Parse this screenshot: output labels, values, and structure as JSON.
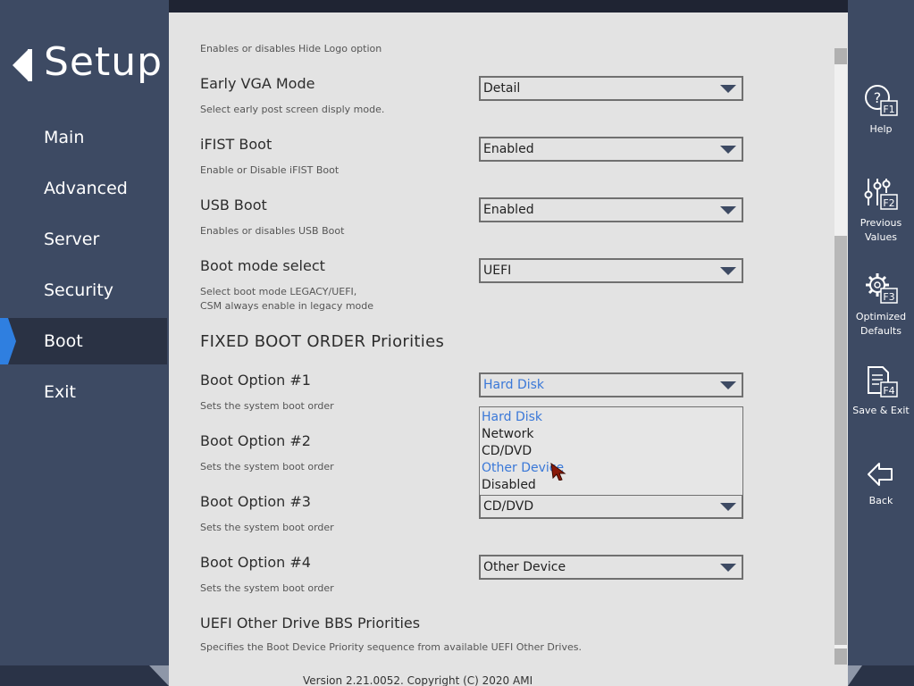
{
  "sidebar": {
    "title": "Setup",
    "items": [
      {
        "label": "Main"
      },
      {
        "label": "Advanced"
      },
      {
        "label": "Server"
      },
      {
        "label": "Security"
      },
      {
        "label": "Boot"
      },
      {
        "label": "Exit"
      }
    ],
    "active": "Boot"
  },
  "settings": {
    "partial_help": "Enables or disables Hide Logo option",
    "early_vga": {
      "label": "Early VGA Mode",
      "help": "Select early post screen disply mode.",
      "value": "Detail"
    },
    "ifist": {
      "label": "iFIST Boot",
      "help": "Enable or Disable iFIST Boot",
      "value": "Enabled"
    },
    "usb_boot": {
      "label": "USB Boot",
      "help": "Enables or disables USB Boot",
      "value": "Enabled"
    },
    "boot_mode": {
      "label": "Boot mode select",
      "help_line1": "Select boot mode LEGACY/UEFI,",
      "help_line2": "CSM always enable in legacy mode",
      "value": "UEFI"
    },
    "fixed_order_title": "FIXED BOOT ORDER Priorities",
    "boot1": {
      "label": "Boot Option #1",
      "help": "Sets the system boot order",
      "value": "Hard Disk"
    },
    "boot2": {
      "label": "Boot Option #2",
      "help": "Sets the system boot order"
    },
    "boot3": {
      "label": "Boot Option #3",
      "help": "Sets the system boot order",
      "value": "CD/DVD"
    },
    "boot4": {
      "label": "Boot Option #4",
      "help": "Sets the system boot order",
      "value": "Other Device"
    },
    "uefi_other": {
      "label": "UEFI Other Drive BBS Priorities",
      "help": "Specifies the Boot Device Priority sequence from available UEFI Other Drives."
    }
  },
  "dropdown": {
    "options": [
      "Hard Disk",
      "Network",
      "CD/DVD",
      "Other Device",
      "Disabled"
    ]
  },
  "footer": {
    "version": "Version 2.21.0052. Copyright (C) 2020 AMI"
  },
  "right_panel": {
    "help": "Help",
    "prev_line1": "Previous",
    "prev_line2": "Values",
    "opt_line1": "Optimized",
    "opt_line2": "Defaults",
    "save_exit": "Save & Exit",
    "back": "Back",
    "keys": {
      "help": "F1",
      "prev": "F2",
      "opt": "F3",
      "save": "F4"
    }
  },
  "colors": {
    "sidebar": "#3d4a63",
    "panel": "#e3e3e3",
    "accent_blue": "#3a78d8",
    "active_marker": "#2f7fe0"
  }
}
